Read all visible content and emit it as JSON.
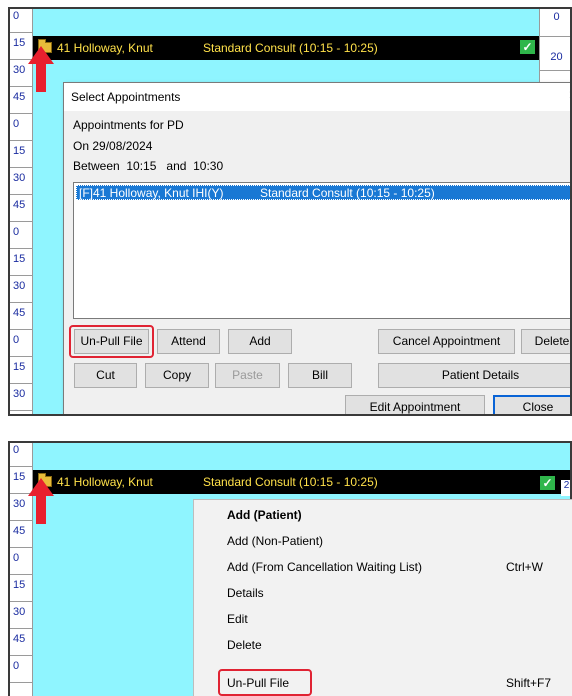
{
  "top_panel": {
    "time_slots": [
      "0",
      "15",
      "30",
      "45",
      "0",
      "15",
      "30",
      "45",
      "0",
      "15",
      "30",
      "45",
      "0",
      "15",
      "30"
    ],
    "right_slots": [
      "0",
      "20"
    ],
    "appointment": {
      "name": "41 Holloway, Knut",
      "description": "Standard Consult (10:15 - 10:25)"
    },
    "dialog": {
      "title": "Select Appointments",
      "close_glyph": "×",
      "line1": "Appointments for PD",
      "line2": "On 29/08/2024",
      "between_label": "Between",
      "between_from": "10:15",
      "between_and": "and",
      "between_to": "10:30",
      "list": [
        {
          "name": "[F]41 Holloway, Knut IHI(Y)",
          "description": "Standard Consult (10:15 - 10:25)"
        }
      ],
      "buttons": {
        "unpull": "Un-Pull File",
        "attend": "Attend",
        "add": "Add",
        "cancel_appointment": "Cancel Appointment",
        "delete": "Delete",
        "cut": "Cut",
        "copy": "Copy",
        "paste": "Paste",
        "bill": "Bill",
        "patient_details": "Patient Details",
        "edit_appointment": "Edit Appointment",
        "close": "Close"
      }
    }
  },
  "bottom_panel": {
    "time_slots": [
      "0",
      "15",
      "30",
      "45",
      "0",
      "15",
      "30",
      "45",
      "0"
    ],
    "appointment": {
      "name": "41 Holloway, Knut",
      "description": "Standard Consult (10:15 - 10:25)"
    },
    "right_partial": "2",
    "context_menu": [
      {
        "label": "Add (Patient)",
        "shortcut": "",
        "bold": true
      },
      {
        "label": "Add (Non-Patient)",
        "shortcut": ""
      },
      {
        "label": "Add (From Cancellation Waiting List)",
        "shortcut": "Ctrl+W"
      },
      {
        "label": "Details",
        "shortcut": ""
      },
      {
        "label": "Edit",
        "shortcut": ""
      },
      {
        "label": "Delete",
        "shortcut": ""
      },
      {
        "label": "Un-Pull File",
        "shortcut": "Shift+F7"
      }
    ]
  },
  "colors": {
    "schedule_bg": "#8ff5ff",
    "appointment_bar": "#000000",
    "appointment_text": "#ffe14a",
    "selection": "#1978d4",
    "highlight": "#e02333",
    "arrow": "#e8202e"
  },
  "icons": [
    "folder-icon",
    "check-icon",
    "red-arrow-icon",
    "close-icon"
  ]
}
